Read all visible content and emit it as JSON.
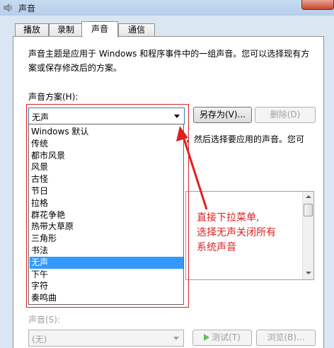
{
  "window": {
    "title": "声音"
  },
  "tabs": [
    {
      "label": "播放"
    },
    {
      "label": "录制"
    },
    {
      "label": "声音",
      "active": true
    },
    {
      "label": "通信"
    }
  ],
  "description": {
    "line1": "声音主题是应用于 Windows 和程序事件中的一组声音。您可以选择现有方",
    "line2": "案或保存修改后的方案。"
  },
  "scheme": {
    "label": "声音方案(H):",
    "selected": "无声",
    "save_as_label": "另存为(V)...",
    "delete_label": "删除(D)",
    "options": [
      "Windows 默认",
      "传统",
      "都市风景",
      "风景",
      "古怪",
      "节日",
      "拉格",
      "群花争艳",
      "热带大草原",
      "三角形",
      "书法",
      "无声",
      "下午",
      "字符",
      "奏鸣曲"
    ],
    "selected_index": 11
  },
  "events_text_fragment": "，然后选择要应用的声音。您可",
  "annotation": {
    "line1": "直接下拉菜单,",
    "line2": "选择无声关闭所有",
    "line3": "系统声音"
  },
  "sound": {
    "label": "声音(S):",
    "selected": "(无)",
    "test_label": "测试(T)",
    "browse_label": "浏览(B)..."
  },
  "colors": {
    "annotation_red": "#e02020",
    "selection_blue": "#3399ff"
  }
}
